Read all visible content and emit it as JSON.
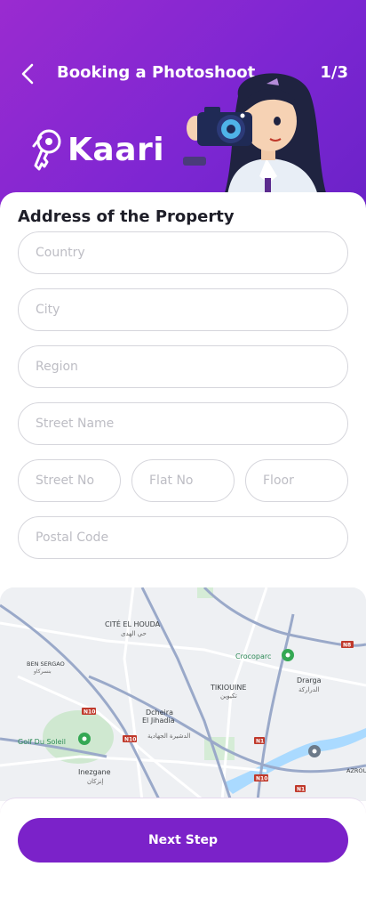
{
  "header": {
    "title": "Booking a Photoshoot",
    "step": "1/3",
    "brand": "Kaari",
    "back_icon": "chevron-left-icon",
    "colors": {
      "gradient_start": "#9a2bd0",
      "gradient_end": "#6b22c8"
    }
  },
  "form": {
    "section_title": "Address of the Property",
    "fields": {
      "country": "Country",
      "city": "City",
      "region": "Region",
      "street_name": "Street Name",
      "street_no": "Street No",
      "flat_no": "Flat No",
      "floor": "Floor",
      "postal_code": "Postal Code"
    }
  },
  "map": {
    "labels": {
      "cite_el_houda": "CITÉ EL HOUDA",
      "cite_el_houda_ar": "حي الهدى",
      "ben_sergao": "BEN SERGAO",
      "ben_sergao_ar": "بنسركاو",
      "crocoparc": "Crocoparc",
      "tikiouine": "TIKIOUINE",
      "tikiouine_ar": "تكيوين",
      "drarga": "Drarga",
      "drarga_ar": "الدراركة",
      "dcheira": "Dcheira",
      "el_jihadia": "El Jihadia",
      "dcheira_ar": "الدشيرة الجهادية",
      "golf_du_soleil": "Golf Du Soleil",
      "inezgane": "Inezgane",
      "inezgane_ar": "إنزكان",
      "azrou": "AZROU",
      "n10_a": "N10",
      "n10_b": "N10",
      "n10_c": "N10",
      "n1_a": "N1",
      "n1_b": "N1",
      "n8": "N8"
    }
  },
  "footer": {
    "next_label": "Next Step",
    "accent": "#7b22c9"
  }
}
